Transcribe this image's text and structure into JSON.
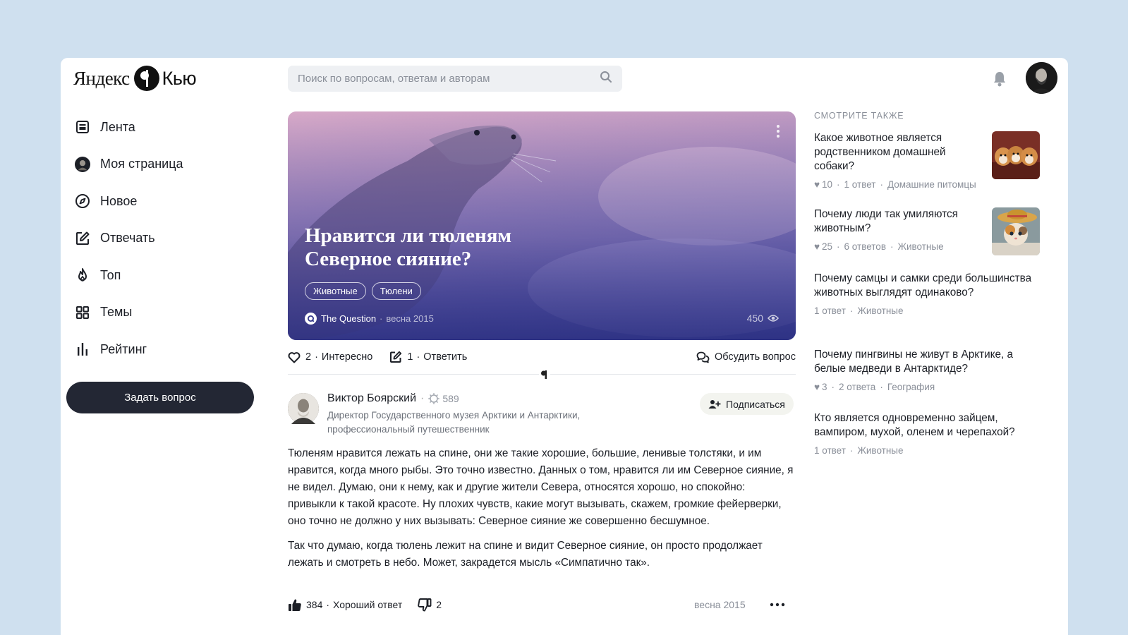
{
  "logo": {
    "brand": "Яндекс",
    "product": "Кью"
  },
  "search": {
    "placeholder": "Поиск по вопросам, ответам и авторам"
  },
  "sidebar": {
    "items": [
      {
        "label": "Лента",
        "icon": "feed-icon"
      },
      {
        "label": "Моя страница",
        "icon": "user-avatar-icon"
      },
      {
        "label": "Новое",
        "icon": "compass-icon"
      },
      {
        "label": "Отвечать",
        "icon": "edit-icon"
      },
      {
        "label": "Топ",
        "icon": "fire-icon"
      },
      {
        "label": "Темы",
        "icon": "grid-icon"
      },
      {
        "label": "Рейтинг",
        "icon": "bars-icon"
      }
    ],
    "ask_button": "Задать вопрос"
  },
  "question": {
    "title": "Нравится ли тюленям Северное сияние?",
    "tags": [
      "Животные",
      "Тюлени"
    ],
    "source": "The Question",
    "date": "весна 2015",
    "views": "450"
  },
  "actions": {
    "interesting_count": "2",
    "interesting_label": "Интересно",
    "answer_count": "1",
    "answer_label": "Ответить",
    "discuss_label": "Обсудить вопрос"
  },
  "answer": {
    "author_name": "Виктор Боярский",
    "author_rating": "589",
    "author_desc": "Директор Государственного музея Арктики и Антарктики, профессиональный путешественник",
    "subscribe_label": "Подписаться",
    "paragraphs": [
      "Тюленям нравится лежать на спине, они же такие хорошие, большие, ленивые толстяки, и им нравится, когда много рыбы. Это точно известно. Данных о том, нравится ли им Северное сияние, я не видел. Думаю, они к нему, как и другие жители Севера, относятся хорошо, но спокойно: привыкли к такой красоте. Ну плохих чувств, какие могут вызывать, скажем, громкие фейерверки, оно точно не должно у них вызывать: Северное сияние же совершенно бесшумное.",
      "Так что думаю, когда тюлень лежит на спине и видит Северное сияние, он просто продолжает лежать и смотреть в небо. Может, закрадется мысль «Симпатично так»."
    ],
    "likes": "384",
    "like_label": "Хороший ответ",
    "dislikes": "2",
    "date": "весна 2015"
  },
  "related": {
    "header": "СМОТРИТЕ ТАКЖЕ",
    "items": [
      {
        "title": "Какое животное является родственником домашней собаки?",
        "likes": "10",
        "answers": "1 ответ",
        "topic": "Домашние питомцы",
        "thumb": "dogs-thumbnail"
      },
      {
        "title": "Почему люди так умиляются животным?",
        "likes": "25",
        "answers": "6 ответов",
        "topic": "Животные",
        "thumb": "kitten-thumbnail"
      },
      {
        "title": "Почему самцы и самки среди большинства животных выглядят одинаково?",
        "likes": "",
        "answers": "1 ответ",
        "topic": "Животные",
        "thumb": ""
      },
      {
        "title": "Почему пингвины не живут в Арктике, а белые медведи в Антарктиде?",
        "likes": "3",
        "answers": "2 ответа",
        "topic": "География",
        "thumb": ""
      },
      {
        "title": "Кто является одновременно зайцем, вампиром, мухой, оленем и черепахой?",
        "likes": "",
        "answers": "1 ответ",
        "topic": "Животные",
        "thumb": ""
      }
    ]
  },
  "colors": {
    "accent_dark": "#232734",
    "hero_top": "#be8cb4",
    "hero_bottom": "#32378c",
    "muted": "#8a8f99"
  }
}
